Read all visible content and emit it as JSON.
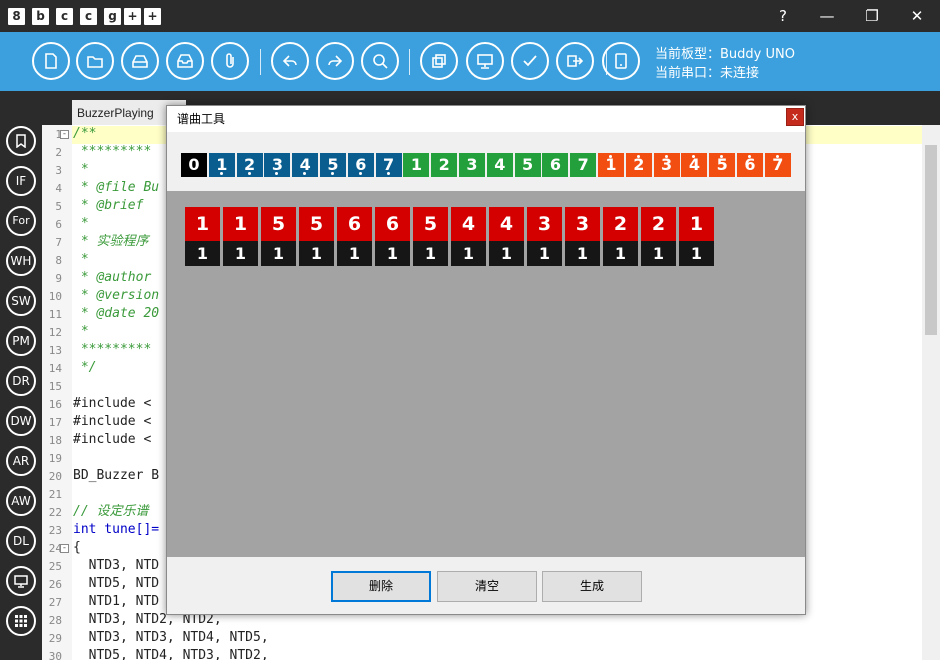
{
  "titlebar": {
    "logo_glyphs": [
      "8",
      "b",
      "c",
      "c",
      "g",
      "+",
      "+"
    ],
    "help": "?",
    "minimize": "—",
    "restore": "❐",
    "close": "✕"
  },
  "toolbar": {
    "icons": [
      "file-icon",
      "folder-open-icon",
      "save-icon",
      "inbox-icon",
      "paperclip-icon",
      "undo-icon",
      "redo-icon",
      "search-icon",
      "copy-icon",
      "monitor-icon",
      "check-icon",
      "upload-icon",
      "tablet-icon"
    ],
    "board_label": "当前板型：Buddy UNO",
    "port_label": "当前串口：未连接"
  },
  "sidebar": {
    "items": [
      {
        "label": "",
        "icon": "bookmark-icon"
      },
      {
        "label": "IF"
      },
      {
        "label": "For"
      },
      {
        "label": "WH"
      },
      {
        "label": "SW"
      },
      {
        "label": "PM"
      },
      {
        "label": "DR"
      },
      {
        "label": "DW"
      },
      {
        "label": "AR"
      },
      {
        "label": "AW"
      },
      {
        "label": "DL"
      },
      {
        "label": "",
        "icon": "monitor-icon"
      },
      {
        "label": "",
        "icon": "grid-icon"
      }
    ]
  },
  "editor": {
    "tab": "BuzzerPlaying",
    "lines": [
      {
        "n": "1",
        "t": "/**",
        "c": "cm"
      },
      {
        "n": "2",
        "t": " *********",
        "c": "cm"
      },
      {
        "n": "3",
        "t": " *",
        "c": "cm"
      },
      {
        "n": "4",
        "t": " * @file Bu",
        "c": "cm"
      },
      {
        "n": "5",
        "t": " * @brief ",
        "c": "cm"
      },
      {
        "n": "6",
        "t": " *",
        "c": "cm"
      },
      {
        "n": "7",
        "t": " * 实验程序",
        "c": "cm"
      },
      {
        "n": "8",
        "t": " *",
        "c": "cm"
      },
      {
        "n": "9",
        "t": " * @author",
        "c": "cm"
      },
      {
        "n": "10",
        "t": " * @version",
        "c": "cm"
      },
      {
        "n": "11",
        "t": " * @date 20",
        "c": "cm"
      },
      {
        "n": "12",
        "t": " *",
        "c": "cm"
      },
      {
        "n": "13",
        "t": " *********",
        "c": "cm"
      },
      {
        "n": "14",
        "t": " */",
        "c": "cm"
      },
      {
        "n": "15",
        "t": "",
        "c": ""
      },
      {
        "n": "16",
        "t": "#include <",
        "c": ""
      },
      {
        "n": "17",
        "t": "#include <",
        "c": ""
      },
      {
        "n": "18",
        "t": "#include <",
        "c": ""
      },
      {
        "n": "19",
        "t": "",
        "c": ""
      },
      {
        "n": "20",
        "t": "BD_Buzzer B",
        "c": ""
      },
      {
        "n": "21",
        "t": "",
        "c": ""
      },
      {
        "n": "22",
        "t": "// 设定乐谱",
        "c": "cm"
      },
      {
        "n": "23",
        "t": "int tune[]=",
        "c": "kw"
      },
      {
        "n": "24",
        "t": "{",
        "c": ""
      },
      {
        "n": "25",
        "t": "  NTD3, NTD",
        "c": ""
      },
      {
        "n": "26",
        "t": "  NTD5, NTD",
        "c": ""
      },
      {
        "n": "27",
        "t": "  NTD1, NTD",
        "c": ""
      },
      {
        "n": "28",
        "t": "  NTD3, NTD2, NTD2,",
        "c": ""
      },
      {
        "n": "29",
        "t": "  NTD3, NTD3, NTD4, NTD5,",
        "c": ""
      },
      {
        "n": "30",
        "t": "  NTD5, NTD4, NTD3, NTD2,",
        "c": ""
      }
    ]
  },
  "dialog": {
    "title": "谱曲工具",
    "close": "x",
    "palette": [
      {
        "label": "0",
        "color": "#000000",
        "dots": "none"
      },
      {
        "label": "1",
        "color": "#0a5e8f",
        "dots": "below"
      },
      {
        "label": "2",
        "color": "#0a5e8f",
        "dots": "below"
      },
      {
        "label": "3",
        "color": "#0a5e8f",
        "dots": "below"
      },
      {
        "label": "4",
        "color": "#0a5e8f",
        "dots": "below"
      },
      {
        "label": "5",
        "color": "#0a5e8f",
        "dots": "below"
      },
      {
        "label": "6",
        "color": "#0a5e8f",
        "dots": "below"
      },
      {
        "label": "7",
        "color": "#0a5e8f",
        "dots": "below"
      },
      {
        "label": "1",
        "color": "#23a03c",
        "dots": "none"
      },
      {
        "label": "2",
        "color": "#23a03c",
        "dots": "none"
      },
      {
        "label": "3",
        "color": "#23a03c",
        "dots": "none"
      },
      {
        "label": "4",
        "color": "#23a03c",
        "dots": "none"
      },
      {
        "label": "5",
        "color": "#23a03c",
        "dots": "none"
      },
      {
        "label": "6",
        "color": "#23a03c",
        "dots": "none"
      },
      {
        "label": "7",
        "color": "#23a03c",
        "dots": "none"
      },
      {
        "label": "1",
        "color": "#f24e12",
        "dots": "above"
      },
      {
        "label": "2",
        "color": "#f24e12",
        "dots": "above"
      },
      {
        "label": "3",
        "color": "#f24e12",
        "dots": "above"
      },
      {
        "label": "4",
        "color": "#f24e12",
        "dots": "above"
      },
      {
        "label": "5",
        "color": "#f24e12",
        "dots": "above"
      },
      {
        "label": "6",
        "color": "#f24e12",
        "dots": "above"
      },
      {
        "label": "7",
        "color": "#f24e12",
        "dots": "above"
      }
    ],
    "notes": [
      {
        "pitch": "1",
        "duration": "1"
      },
      {
        "pitch": "1",
        "duration": "1"
      },
      {
        "pitch": "5",
        "duration": "1"
      },
      {
        "pitch": "5",
        "duration": "1"
      },
      {
        "pitch": "6",
        "duration": "1"
      },
      {
        "pitch": "6",
        "duration": "1"
      },
      {
        "pitch": "5",
        "duration": "1"
      },
      {
        "pitch": "4",
        "duration": "1"
      },
      {
        "pitch": "4",
        "duration": "1"
      },
      {
        "pitch": "3",
        "duration": "1"
      },
      {
        "pitch": "3",
        "duration": "1"
      },
      {
        "pitch": "2",
        "duration": "1"
      },
      {
        "pitch": "2",
        "duration": "1"
      },
      {
        "pitch": "1",
        "duration": "1"
      }
    ],
    "buttons": {
      "delete": "删除",
      "clear": "清空",
      "generate": "生成"
    }
  }
}
